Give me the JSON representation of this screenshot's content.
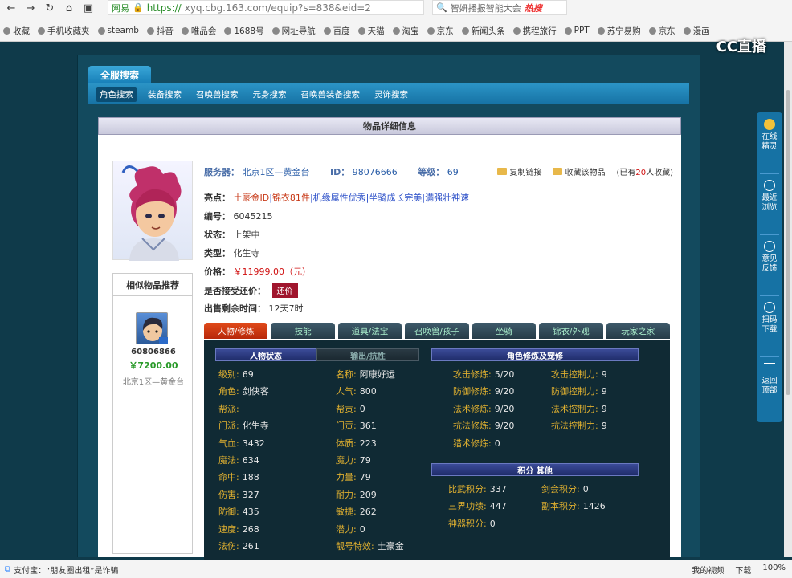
{
  "browser": {
    "tab_label": "网易",
    "url_scheme": "https://",
    "url_rest": "xyq.cbg.163.com/equip?s=838&eid=2",
    "search_text": "智妍播报智能大会",
    "search_badge": "热搜",
    "bookmarks": [
      "收藏",
      "手机收藏夹",
      "steamb",
      "抖音",
      "唯品会",
      "1688号",
      "网址导航",
      "百度",
      "天猫",
      "淘宝",
      "京东",
      "新闻头条",
      "携程旅行",
      "PPT",
      "苏宁易购",
      "京东",
      "漫画"
    ]
  },
  "site": {
    "logo_text": "CC直播",
    "main_tab": "全服搜索",
    "subnav": [
      "角色搜索",
      "装备搜索",
      "召唤兽搜索",
      "元身搜索",
      "召唤兽装备搜索",
      "灵饰搜索"
    ],
    "content_title": "物品详细信息"
  },
  "item": {
    "server_label": "服务器：",
    "server_value": "北京1区—黄金台",
    "id_label": "ID：",
    "id_value": "98076666",
    "level_label": "等级：",
    "level_value": "69",
    "copy_link": "复制链接",
    "collect": "收藏该物品",
    "collect_prefix": "(已有",
    "collect_count": "20",
    "collect_suffix": "人收藏)",
    "highlights_label": "亮点：",
    "highlights": [
      "土豪金ID",
      "锦衣81件",
      "机缘属性优秀",
      "坐骑成长完美",
      "满强壮神速"
    ],
    "number_label": "编号：",
    "number_value": "6045215",
    "status_label": "状态：",
    "status_value": "上架中",
    "type_label": "类型：",
    "type_value": "化生寺",
    "price_label": "价格：",
    "price_value": "￥11999.00（元）",
    "counter_label": "是否接受还价：",
    "counter_button": "还价",
    "remain_label": "出售剩余时间：",
    "remain_value": "12天7时"
  },
  "similar": {
    "title": "相似物品推荐",
    "id": "60806866",
    "price": "￥7200.00",
    "server": "北京1区—黄金台"
  },
  "detail_tabs": [
    "人物/修炼",
    "技能",
    "道具/法宝",
    "召唤兽/孩子",
    "坐骑",
    "锦衣/外观",
    "玩家之家"
  ],
  "sections": {
    "char_status": "人物状态",
    "output_resist": "输出/抗性",
    "cultivation": "角色修炼及宠修",
    "points": "积分 其他"
  },
  "stats_left": [
    {
      "k": "级别:",
      "v": "69"
    },
    {
      "k": "角色:",
      "v": "剑侠客"
    },
    {
      "k": "帮派:",
      "v": ""
    },
    {
      "k": "门派:",
      "v": "化生寺"
    },
    {
      "k": "气血:",
      "v": "3432"
    },
    {
      "k": "魔法:",
      "v": "634"
    },
    {
      "k": "命中:",
      "v": "188"
    },
    {
      "k": "伤害:",
      "v": "327"
    },
    {
      "k": "防御:",
      "v": "435"
    },
    {
      "k": "速度:",
      "v": "268"
    },
    {
      "k": "法伤:",
      "v": "261"
    }
  ],
  "stats_mid": [
    {
      "k": "名称:",
      "v": "阿康好运"
    },
    {
      "k": "人气:",
      "v": "800"
    },
    {
      "k": "帮贡:",
      "v": "0"
    },
    {
      "k": "门贡:",
      "v": "361"
    },
    {
      "k": "体质:",
      "v": "223"
    },
    {
      "k": "魔力:",
      "v": "79"
    },
    {
      "k": "力量:",
      "v": "79"
    },
    {
      "k": "耐力:",
      "v": "209"
    },
    {
      "k": "敏捷:",
      "v": "262"
    },
    {
      "k": "潜力:",
      "v": "0"
    },
    {
      "k": "靓号特效:",
      "v": "土豪金"
    }
  ],
  "cultivation": [
    {
      "k": "攻击修炼:",
      "v": "5/20",
      "k2": "攻击控制力:",
      "v2": "9"
    },
    {
      "k": "防御修炼:",
      "v": "9/20",
      "k2": "防御控制力:",
      "v2": "9"
    },
    {
      "k": "法术修炼:",
      "v": "9/20",
      "k2": "法术控制力:",
      "v2": "9"
    },
    {
      "k": "抗法修炼:",
      "v": "9/20",
      "k2": "抗法控制力:",
      "v2": "9"
    },
    {
      "k": "猎术修炼:",
      "v": "0",
      "k2": "",
      "v2": ""
    }
  ],
  "points": [
    {
      "k": "比武积分:",
      "v": "337",
      "k2": "剑会积分:",
      "v2": "0"
    },
    {
      "k": "三界功绩:",
      "v": "447",
      "k2": "副本积分:",
      "v2": "1426"
    },
    {
      "k": "神器积分:",
      "v": "0",
      "k2": "",
      "v2": ""
    }
  ],
  "right_sidebar": [
    {
      "label": "在线精灵"
    },
    {
      "label": "最近浏览"
    },
    {
      "label": "意见反馈"
    },
    {
      "label": "扫码下载"
    },
    {
      "label": "返回顶部"
    }
  ],
  "statusbar": {
    "left_text": "支付宝：“朋友圈出租”是诈骗",
    "video": "我的视频",
    "download": "下载",
    "zoom": "100%"
  }
}
